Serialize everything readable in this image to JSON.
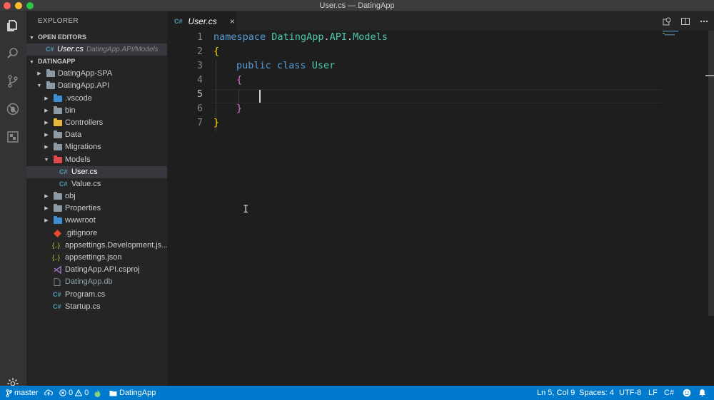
{
  "window": {
    "title": "User.cs — DatingApp"
  },
  "explorer": {
    "header": "EXPLORER",
    "open_editors": {
      "label": "OPEN EDITORS",
      "items": [
        {
          "icon": "C#",
          "name": "User.cs",
          "path": "DatingApp.API/Models"
        }
      ]
    },
    "project": {
      "label": "DATINGAPP",
      "tree": [
        {
          "name": "DatingApp-SPA",
          "kind": "folder"
        },
        {
          "name": "DatingApp.API",
          "kind": "folder-open"
        },
        {
          "name": ".vscode",
          "kind": "folder"
        },
        {
          "name": "bin",
          "kind": "folder"
        },
        {
          "name": "Controllers",
          "kind": "folder"
        },
        {
          "name": "Data",
          "kind": "folder"
        },
        {
          "name": "Migrations",
          "kind": "folder"
        },
        {
          "name": "Models",
          "kind": "folder-open"
        },
        {
          "name": "User.cs",
          "kind": "file",
          "icon": "C#"
        },
        {
          "name": "Value.cs",
          "kind": "file",
          "icon": "C#"
        },
        {
          "name": "obj",
          "kind": "folder"
        },
        {
          "name": "Properties",
          "kind": "folder"
        },
        {
          "name": "wwwroot",
          "kind": "folder"
        },
        {
          "name": ".gitignore",
          "kind": "file"
        },
        {
          "name": "appsettings.Development.js...",
          "kind": "file",
          "icon": "{..}"
        },
        {
          "name": "appsettings.json",
          "kind": "file",
          "icon": "{..}"
        },
        {
          "name": "DatingApp.API.csproj",
          "kind": "file"
        },
        {
          "name": "DatingApp.db",
          "kind": "file"
        },
        {
          "name": "Program.cs",
          "kind": "file",
          "icon": "C#"
        },
        {
          "name": "Startup.cs",
          "kind": "file",
          "icon": "C#"
        }
      ]
    }
  },
  "tab": {
    "icon": "C#",
    "label": "User.cs",
    "close": "×"
  },
  "editor": {
    "line_numbers": [
      "1",
      "2",
      "3",
      "4",
      "5",
      "6",
      "7"
    ],
    "code": {
      "l1_kw": "namespace",
      "l1_ns1": "DatingApp",
      "l1_dot1": ".",
      "l1_ns2": "API",
      "l1_dot2": ".",
      "l1_ns3": "Models",
      "l2_brace": "{",
      "l3_kw1": "public",
      "l3_kw2": "class",
      "l3_type": "User",
      "l4_brace": "{",
      "l6_brace": "}",
      "l7_brace": "}"
    }
  },
  "statusbar": {
    "branch": "master",
    "errors": "0",
    "warnings": "0",
    "project": "DatingApp",
    "position": "Ln 5, Col 9",
    "spaces": "Spaces: 4",
    "encoding": "UTF-8",
    "eol": "LF",
    "language": "C#"
  },
  "colors": {
    "accent": "#007acc",
    "keyword": "#569cd6",
    "type": "#4ec9b0",
    "bracket_1": "#ffd700",
    "bracket_2": "#da70d6"
  }
}
